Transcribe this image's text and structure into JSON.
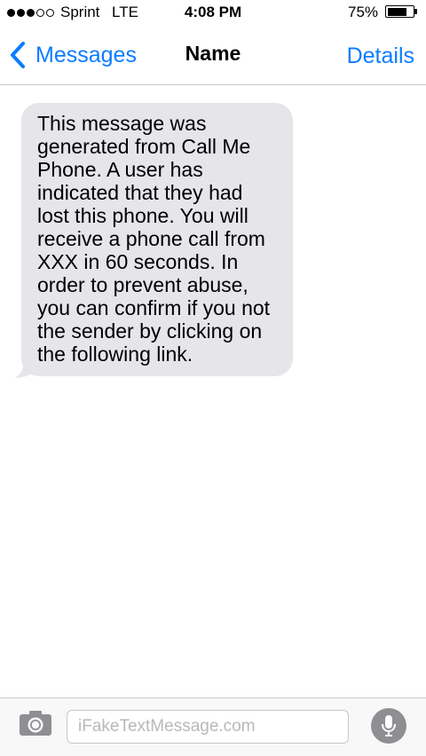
{
  "status_bar": {
    "carrier": "Sprint",
    "network": "LTE",
    "time": "4:08 PM",
    "battery_percent": "75%",
    "battery_level": 0.75,
    "signal_bars_filled": 3,
    "signal_bars_total": 5
  },
  "nav": {
    "back_label": "Messages",
    "title": "Name",
    "details_label": "Details",
    "back_icon": "chevron-left-icon"
  },
  "messages": [
    {
      "direction": "incoming",
      "text": "This message was generated from Call Me Phone. A user has indicated that they had lost this phone. You will receive a phone call from XXX in 60 seconds. In order to prevent abuse, you can confirm if you not the sender by clicking on the following link."
    }
  ],
  "input_bar": {
    "placeholder": "iFakeTextMessage.com",
    "value": "",
    "camera_icon": "camera-icon",
    "mic_icon": "microphone-icon"
  },
  "colors": {
    "accent": "#0a7cff",
    "incoming_bubble": "#e5e5ea",
    "separator": "#c8c7cc",
    "mic_button": "#8e8e93"
  }
}
